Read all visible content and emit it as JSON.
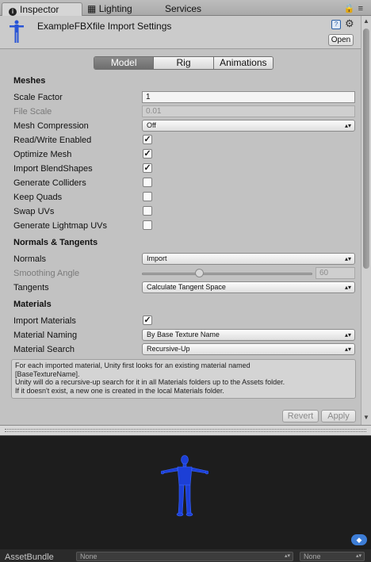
{
  "tabs": {
    "inspector": "Inspector",
    "lighting": "Lighting",
    "services": "Services"
  },
  "header": {
    "title": "ExampleFBXfile Import Settings",
    "open_label": "Open"
  },
  "model_tabs": [
    "Model",
    "Rig",
    "Animations"
  ],
  "selected_tab": "Model",
  "meshes": {
    "heading": "Meshes",
    "scale_factor_label": "Scale Factor",
    "scale_factor_value": "1",
    "file_scale_label": "File Scale",
    "file_scale_value": "0.01",
    "mesh_compression_label": "Mesh Compression",
    "mesh_compression_value": "Off",
    "read_write_label": "Read/Write Enabled",
    "read_write_checked": true,
    "optimize_mesh_label": "Optimize Mesh",
    "optimize_mesh_checked": true,
    "import_blendshapes_label": "Import BlendShapes",
    "import_blendshapes_checked": true,
    "generate_colliders_label": "Generate Colliders",
    "generate_colliders_checked": false,
    "keep_quads_label": "Keep Quads",
    "keep_quads_checked": false,
    "swap_uvs_label": "Swap UVs",
    "swap_uvs_checked": false,
    "lightmap_uvs_label": "Generate Lightmap UVs",
    "lightmap_uvs_checked": false
  },
  "normals": {
    "heading": "Normals & Tangents",
    "normals_label": "Normals",
    "normals_value": "Import",
    "smoothing_label": "Smoothing Angle",
    "smoothing_value": "60",
    "smoothing_fraction": 0.333,
    "tangents_label": "Tangents",
    "tangents_value": "Calculate Tangent Space"
  },
  "materials": {
    "heading": "Materials",
    "import_materials_label": "Import Materials",
    "import_materials_checked": true,
    "naming_label": "Material Naming",
    "naming_value": "By Base Texture Name",
    "search_label": "Material Search",
    "search_value": "Recursive-Up"
  },
  "help_lines": [
    "For each imported material, Unity first looks for an existing material named",
    "[BaseTextureName].",
    "Unity will do a recursive-up search for it in all Materials folders up to the Assets folder.",
    "If it doesn't exist, a new one is created in the local Materials folder."
  ],
  "buttons": {
    "revert": "Revert",
    "apply": "Apply"
  },
  "asset_bundle": {
    "label": "AssetBundle",
    "name_value": "None",
    "variant_value": "None"
  },
  "colors": {
    "figure_blue": "#1c3fd6",
    "tag_blue": "#3d7dd6"
  }
}
